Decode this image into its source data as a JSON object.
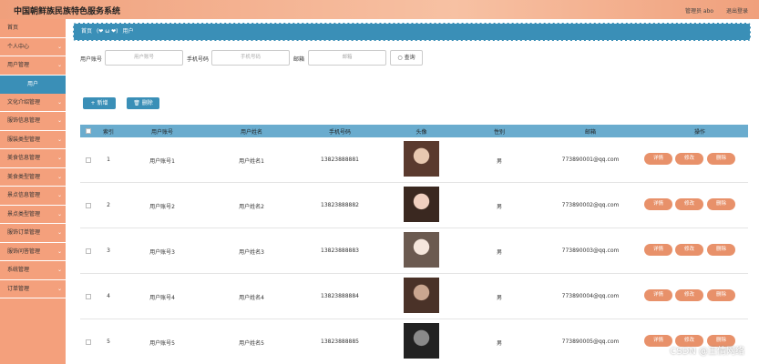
{
  "app": {
    "title": "中国朝鲜族民族特色服务系统"
  },
  "topbar": {
    "user": "管理员 abo",
    "logout": "退出登录"
  },
  "sidebar": {
    "items": [
      {
        "label": "首页",
        "has_children": false
      },
      {
        "label": "个人中心",
        "has_children": true
      },
      {
        "label": "用户管理",
        "has_children": true,
        "active": true
      },
      {
        "label": "文化介绍管理",
        "has_children": true
      },
      {
        "label": "服饰信息管理",
        "has_children": true
      },
      {
        "label": "服装类型管理",
        "has_children": true
      },
      {
        "label": "美食信息管理",
        "has_children": true
      },
      {
        "label": "美食类型管理",
        "has_children": true
      },
      {
        "label": "景点信息管理",
        "has_children": true
      },
      {
        "label": "景点类型管理",
        "has_children": true
      },
      {
        "label": "服饰订单管理",
        "has_children": true
      },
      {
        "label": "服饰问答管理",
        "has_children": true
      },
      {
        "label": "系统管理",
        "has_children": true
      },
      {
        "label": "订单管理",
        "has_children": true
      }
    ],
    "sub_active": "用户"
  },
  "breadcrumb": {
    "home": "首页",
    "sep": "(❤ ω ❤)",
    "current": "用户"
  },
  "search": {
    "account_label": "用户账号",
    "account_placeholder": "用户账号",
    "phone_label": "手机号码",
    "phone_placeholder": "手机号码",
    "email_label": "邮箱",
    "email_placeholder": "邮箱",
    "query_button": "○ 查询"
  },
  "actions": {
    "add": "+ 新增",
    "delete": "🗑 删除"
  },
  "table": {
    "headers": [
      "索引",
      "用户账号",
      "用户姓名",
      "手机号码",
      "头像",
      "性别",
      "邮箱",
      "操作"
    ],
    "rows": [
      {
        "index": "1",
        "account": "用户账号1",
        "name": "用户姓名1",
        "phone": "13823888881",
        "gender": "男",
        "email": "773890001@qq.com"
      },
      {
        "index": "2",
        "account": "用户账号2",
        "name": "用户姓名2",
        "phone": "13823888882",
        "gender": "男",
        "email": "773890002@qq.com"
      },
      {
        "index": "3",
        "account": "用户账号3",
        "name": "用户姓名3",
        "phone": "13823888883",
        "gender": "男",
        "email": "773890003@qq.com"
      },
      {
        "index": "4",
        "account": "用户账号4",
        "name": "用户姓名4",
        "phone": "13823888884",
        "gender": "男",
        "email": "773890004@qq.com"
      },
      {
        "index": "5",
        "account": "用户账号5",
        "name": "用户姓名5",
        "phone": "13823888885",
        "gender": "男",
        "email": "773890005@qq.com"
      }
    ],
    "row_buttons": {
      "detail": "详情",
      "edit": "修改",
      "delete": "删除"
    }
  },
  "watermark": "CSDN @王倩网络",
  "colors": {
    "accent": "#3a8fb7",
    "brand": "#f4a07c",
    "button": "#e8916a"
  }
}
